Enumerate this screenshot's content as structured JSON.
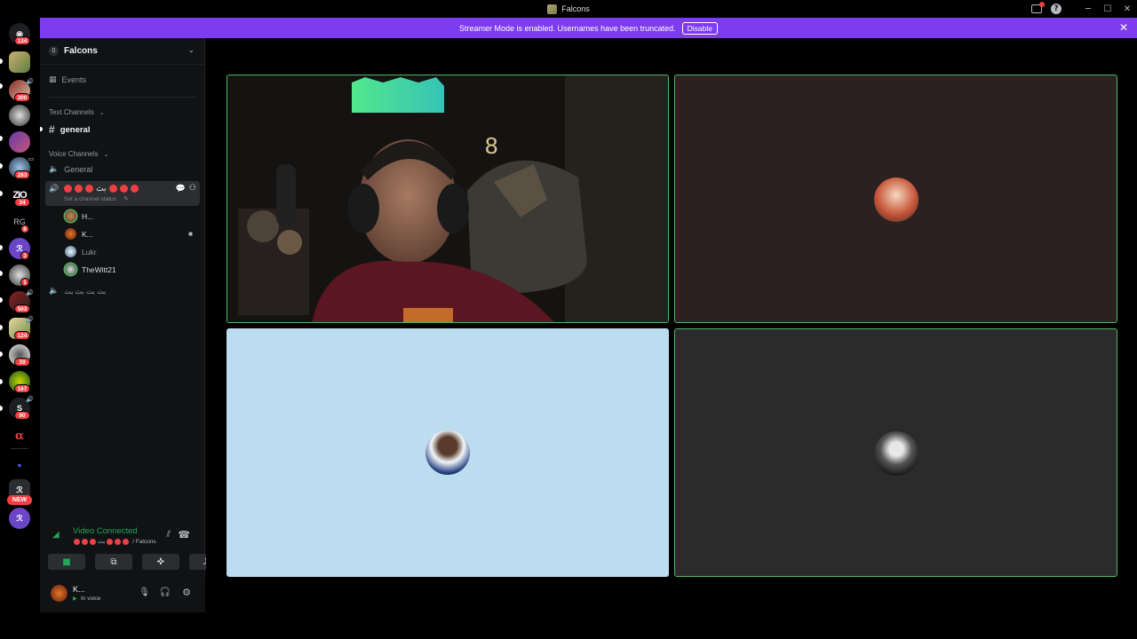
{
  "window": {
    "title": "Falcons"
  },
  "banner": {
    "text": "Streamer Mode is enabled. Usernames have been truncated.",
    "button": "Disable"
  },
  "rail": {
    "badges": [
      "134",
      "300",
      "283",
      "34",
      "6",
      "3",
      "1",
      "503",
      "124",
      "39",
      "167",
      "90"
    ],
    "zio_label": "ZIO",
    "rg_label": "RG",
    "new_label": "NEW"
  },
  "server": {
    "name": "Falcons",
    "icon_label": "0"
  },
  "channels": {
    "events": "Events",
    "text_category": "Text Channels",
    "general_text": "general",
    "voice_category": "Voice Channels",
    "general_voice": "General",
    "active_voice_name": "بث",
    "channel_status": "Set a channel status",
    "other_voice": "بث بث بث بث"
  },
  "members": [
    {
      "name": "H..."
    },
    {
      "name": "K..."
    },
    {
      "name": "Lukr"
    },
    {
      "name": "TheWitt21"
    }
  ],
  "voice_connection": {
    "status": "Video Connected",
    "channel_glyph": "بث",
    "server": "/ Falcons"
  },
  "user": {
    "name": "K...",
    "status": "In voice"
  },
  "colors": {
    "accent_purple": "#7d3cf0",
    "connected_green": "#23a55a",
    "danger_red": "#f23f43",
    "speaking_green": "#4fb86a"
  }
}
